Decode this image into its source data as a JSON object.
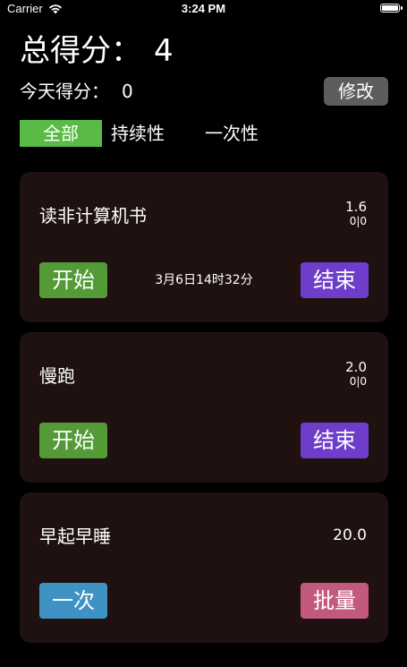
{
  "status_bar": {
    "carrier": "Carrier",
    "time": "3:24 PM",
    "wifi_icon": "wifi-icon",
    "battery_icon": "battery-icon"
  },
  "header": {
    "total_label": "总得分：",
    "total_value": "4",
    "today_label": "今天得分：",
    "today_value": "0",
    "edit_label": "修改"
  },
  "filters": [
    {
      "label": "全部",
      "active": true
    },
    {
      "label": "持续性",
      "active": false
    },
    {
      "label": "一次性",
      "active": false
    }
  ],
  "tasks": [
    {
      "name": "读非计算机书",
      "score": "1.6",
      "count": "0|0",
      "left_button": "开始",
      "start_time": "3月6日14时32分",
      "right_button": "结束"
    },
    {
      "name": "慢跑",
      "score": "2.0",
      "count": "0|0",
      "left_button": "开始",
      "right_button": "结束"
    },
    {
      "name": "早起早睡",
      "score": "20.0",
      "left_button": "一次",
      "right_button": "批量"
    }
  ],
  "colors": {
    "background": "#000000",
    "card": "#1e1110",
    "active_tab": "#59bb45",
    "start_button": "#549b38",
    "finish_button": "#6f3ccb",
    "once_button": "#3f93c4",
    "batch_button": "#c25a7e",
    "edit_button": "#5d5d5d"
  }
}
